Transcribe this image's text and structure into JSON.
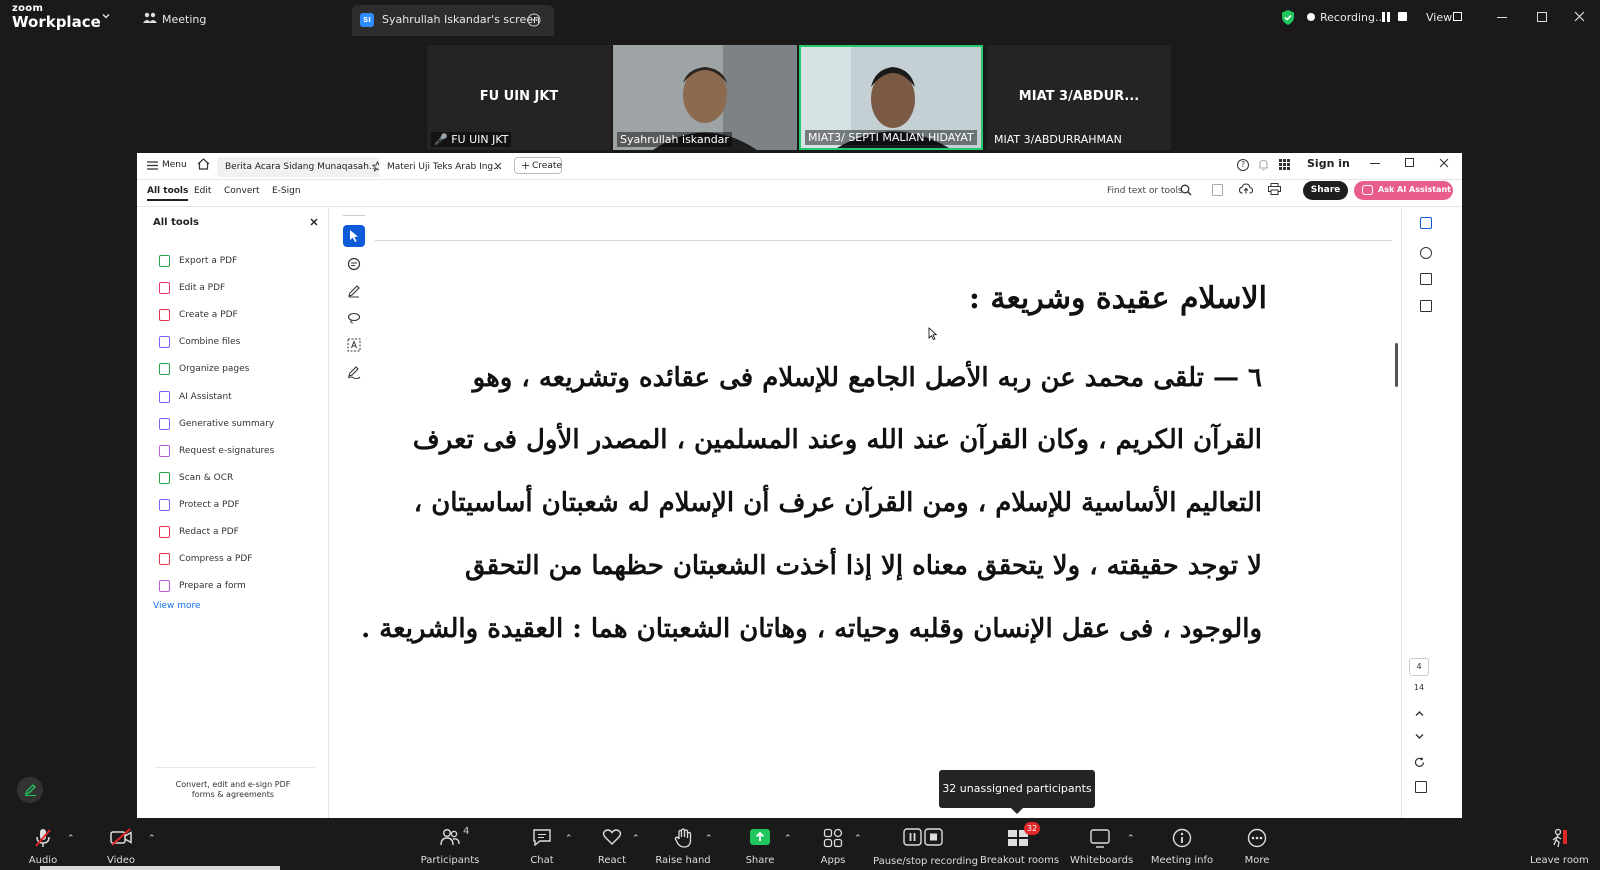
{
  "topbar": {
    "logo_top": "zoom",
    "logo_bottom": "Workplace",
    "meeting_label": "Meeting",
    "share_tab_initials": "SI",
    "share_tab_label": "Syahrullah Iskandar's screen",
    "recording_label": "Recording...",
    "view_label": "View"
  },
  "gallery": [
    {
      "name_center": "FU UIN JKT",
      "label": "FU UIN JKT",
      "muted": true
    },
    {
      "name_center": "",
      "label": "Syahrullah iskandar",
      "muted": false
    },
    {
      "name_center": "",
      "label": "MIAT3/ SEPTI MALIAN HIDAYAT",
      "muted": false,
      "active_speaker": true
    },
    {
      "name_center": "MIAT 3/ABDUR...",
      "label": "MIAT 3/ABDURRAHMAN",
      "muted": false
    }
  ],
  "acrobat": {
    "menu_label": "Menu",
    "tabs": [
      "Berita Acara Sidang Munaqasah...",
      "Materi Uji Teks Arab Ing..."
    ],
    "create_label": "Create",
    "sign_in": "Sign in",
    "menubar": [
      "All tools",
      "Edit",
      "Convert",
      "E-Sign"
    ],
    "find_placeholder": "Find text or tools",
    "share_label": "Share",
    "ai_label": "Ask AI Assistant",
    "panel_title": "All tools",
    "tools": [
      "Export a PDF",
      "Edit a PDF",
      "Create a PDF",
      "Combine files",
      "Organize pages",
      "AI Assistant",
      "Generative summary",
      "Request e-signatures",
      "Scan & OCR",
      "Protect a PDF",
      "Redact a PDF",
      "Compress a PDF",
      "Prepare a form"
    ],
    "view_more": "View more",
    "footer_text": "Convert, edit and e-sign PDF forms & agreements",
    "page_current": "4",
    "page_total": "14",
    "doc_lines": [
      "الاسلام عقيدة وشريعة :",
      "٦ — تلقى محمد عن ربه الأصل الجامع للإسلام فى عقائده وتشريعه ، وهو",
      "القرآن الكريم ، وكان القرآن عند الله وعند المسلمين ، المصدر الأول فى تعرف",
      "التعاليم الأساسية للإسلام ، ومن القرآن عرف أن الإسلام له شعبتان أساسيتان ،",
      "لا توجد حقيقته ، ولا يتحقق معناه إلا إذا أخذت الشعبتان حظهما من التحقق",
      "والوجود ، فى عقل الإنسان وقلبه وحياته ، وهاتان الشعبتان هما : العقيدة والشريعة ."
    ]
  },
  "tooltip": "32 unassigned participants",
  "bottombar": {
    "audio": "Audio",
    "video": "Video",
    "participants": "Participants",
    "participants_count": "4",
    "chat": "Chat",
    "react": "React",
    "raise_hand": "Raise hand",
    "share": "Share",
    "apps": "Apps",
    "pause_recording": "Pause/stop recording",
    "breakout": "Breakout rooms",
    "breakout_badge": "32",
    "whiteboards": "Whiteboards",
    "meeting_info": "Meeting info",
    "more": "More",
    "leave": "Leave room"
  },
  "colors": {
    "accent_blue": "#0b5cd6",
    "share_green": "#21c55d",
    "ai_pink": "#e85d8d",
    "active_border": "#24c96e",
    "leave_red": "#e02828"
  }
}
